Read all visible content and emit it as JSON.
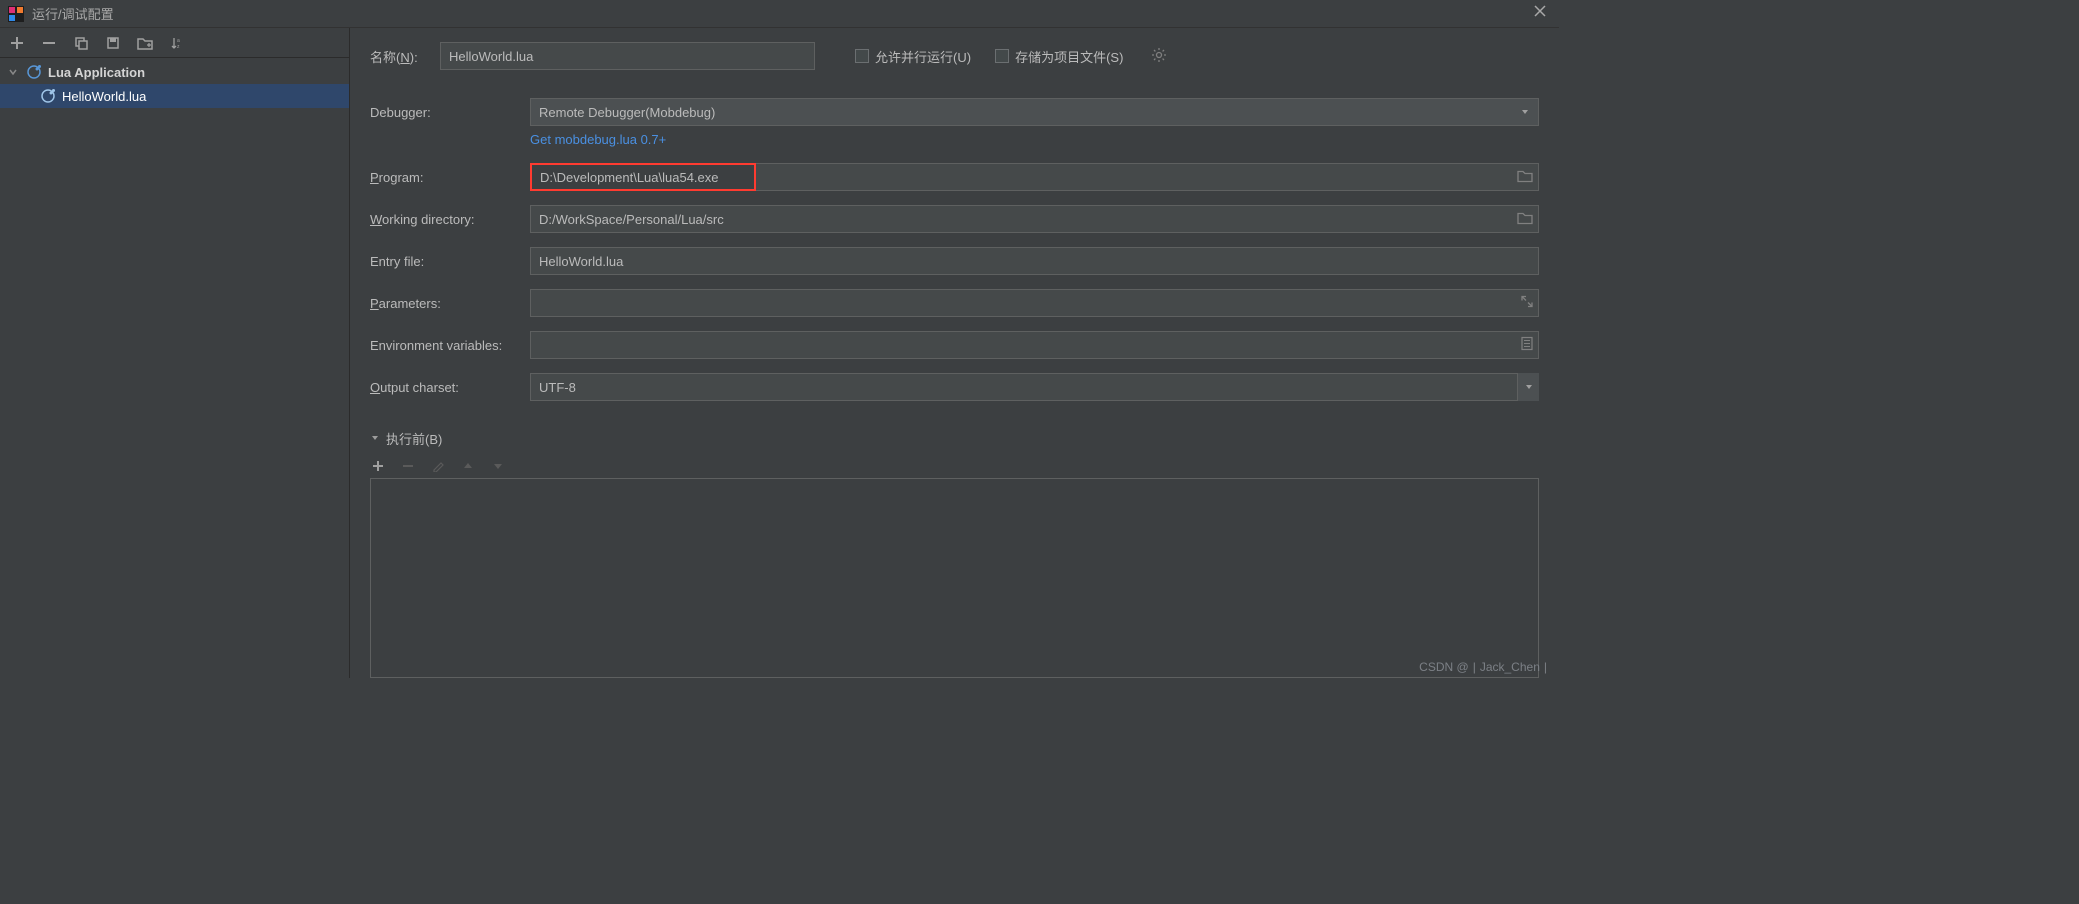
{
  "window": {
    "title": "运行/调试配置"
  },
  "sidebar": {
    "root_label": "Lua Application",
    "items": [
      {
        "label": "HelloWorld.lua"
      }
    ]
  },
  "form": {
    "name_label_prefix": "名称(",
    "name_label_mnemonic": "N",
    "name_label_suffix": "):",
    "name_value": "HelloWorld.lua",
    "allow_parallel_label_prefix": "允许并行运行(",
    "allow_parallel_mnemonic": "U",
    "allow_parallel_suffix": ")",
    "store_as_file_label_prefix": "存储为项目文件(",
    "store_as_file_mnemonic": "S",
    "store_as_file_suffix": ")",
    "debugger_label": "Debugger:",
    "debugger_value": "Remote Debugger(Mobdebug)",
    "mobdebug_link": "Get mobdebug.lua 0.7+",
    "program_label_pre": "",
    "program_mnemonic": "P",
    "program_label_post": "rogram:",
    "program_value": "D:\\Development\\Lua\\lua54.exe",
    "workdir_mnemonic": "W",
    "workdir_label_post": "orking directory:",
    "workdir_value": "D:/WorkSpace/Personal/Lua/src",
    "entry_label": "Entry file:",
    "entry_value": "HelloWorld.lua",
    "params_mnemonic": "P",
    "params_label_post": "arameters:",
    "params_value": "",
    "env_label": "Environment variables:",
    "env_value": "",
    "charset_mnemonic": "O",
    "charset_label_post": "utput charset:",
    "charset_value": "UTF-8",
    "before_label_prefix": "执行前(",
    "before_mnemonic": "B",
    "before_suffix": ")"
  },
  "watermark": {
    "site": "CSDN @",
    "author": "Jack_Chen"
  }
}
